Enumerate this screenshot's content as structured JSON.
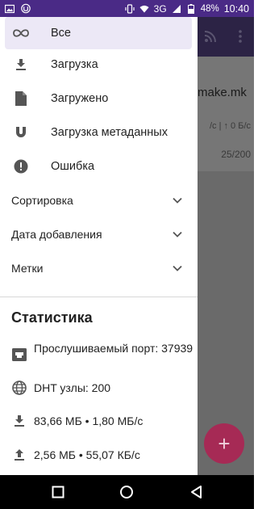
{
  "status_bar": {
    "battery": "48%",
    "network": "3G",
    "time": "10:40"
  },
  "drawer": {
    "items": [
      {
        "label": "Все",
        "icon": "infinity-icon",
        "selected": true
      },
      {
        "label": "Загрузка",
        "icon": "download-icon"
      },
      {
        "label": "Загружено",
        "icon": "file-icon"
      },
      {
        "label": "Загрузка метаданных",
        "icon": "magnet-icon"
      },
      {
        "label": "Ошибка",
        "icon": "error-icon"
      }
    ],
    "sections": [
      {
        "label": "Сортировка"
      },
      {
        "label": "Дата добавления"
      },
      {
        "label": "Метки"
      }
    ],
    "statistics": {
      "title": "Статистика",
      "listen_port": "Прослушиваемый порт: 37939",
      "dht_nodes": "DHT узлы: 200",
      "download": "83,66 МБ • 1,80 МБ/с",
      "upload": "2,56 МБ • 55,07 КБ/с"
    }
  },
  "app_behind": {
    "torrent_title": "make.mk",
    "speeds": "/с | ↑ 0 Б/с",
    "peers": "25/200",
    "fab": "+"
  },
  "colors": {
    "status_bar": "#4a2a86",
    "accent_fab": "#a62a55",
    "selected_bg": "#ece8f6"
  }
}
